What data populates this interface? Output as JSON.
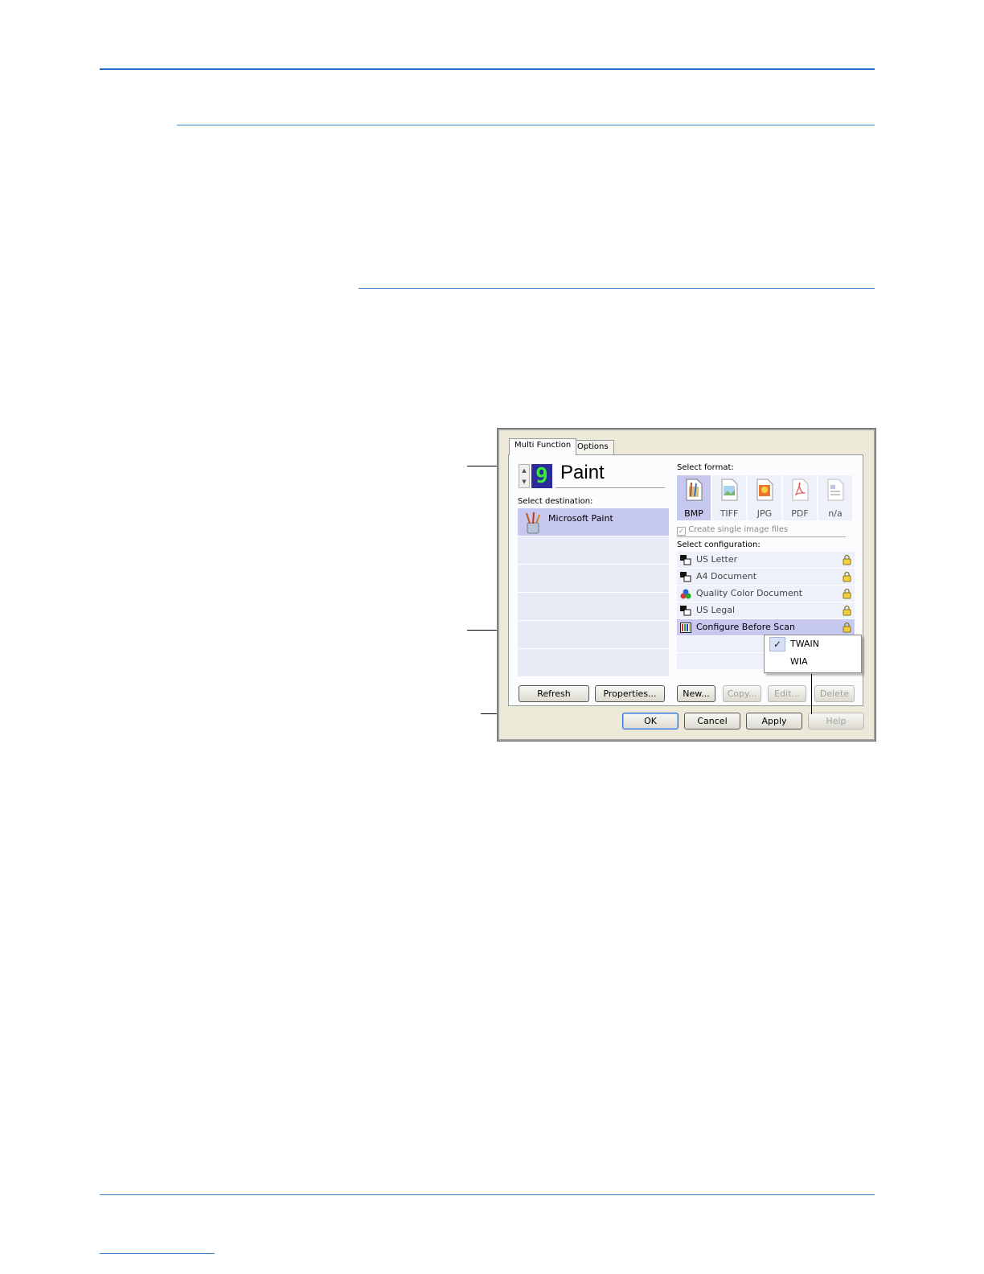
{
  "dialog": {
    "tabs": [
      {
        "label": "Multi Function"
      },
      {
        "label": "Options"
      }
    ],
    "button_number": "9",
    "destination_name": "Paint",
    "select_destination_label": "Select destination:",
    "destinations": [
      {
        "label": "Microsoft Paint"
      }
    ],
    "select_format_label": "Select format:",
    "formats": [
      {
        "label": "BMP"
      },
      {
        "label": "TIFF"
      },
      {
        "label": "JPG"
      },
      {
        "label": "PDF"
      },
      {
        "label": "n/a"
      }
    ],
    "single_image_label": "Create single image files",
    "select_configuration_label": "Select configuration:",
    "configurations": [
      {
        "label": "US Letter"
      },
      {
        "label": "A4 Document"
      },
      {
        "label": "Quality Color Document"
      },
      {
        "label": "US Legal"
      },
      {
        "label": "Configure Before Scan"
      }
    ],
    "context_menu": [
      {
        "label": "TWAIN",
        "check": "✓"
      },
      {
        "label": "WIA"
      }
    ],
    "buttons": {
      "refresh": "Refresh",
      "properties": "Properties...",
      "new": "New...",
      "copy": "Copy...",
      "edit": "Edit...",
      "delete": "Delete",
      "ok": "OK",
      "cancel": "Cancel",
      "apply": "Apply",
      "help": "Help"
    }
  },
  "colors": {
    "rule": "#1f6fc4",
    "selection": "#c6c8f0",
    "row": "#eef0fa"
  }
}
